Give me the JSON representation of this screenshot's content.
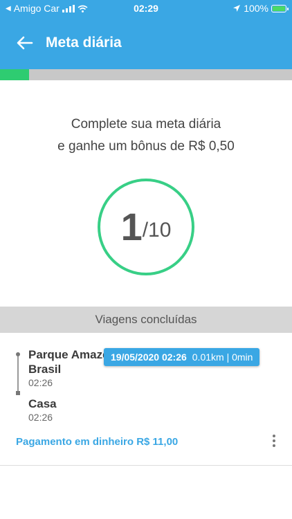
{
  "status_bar": {
    "carrier": "Amigo Car",
    "time": "02:29",
    "battery": "100%"
  },
  "appbar": {
    "title": "Meta diária",
    "back_icon": "arrow-left-icon"
  },
  "goal_progress": {
    "fraction": 0.1,
    "fill_color": "#2ecc71"
  },
  "intro": {
    "line1": "Complete sua meta diária",
    "line2": "e ganhe um bônus de R$ 0,50"
  },
  "goal": {
    "current": "1",
    "total": "/10"
  },
  "section": {
    "title": "Viagens concluídas"
  },
  "trip": {
    "origin_line1": "Parque Amaze",
    "origin_line2": "Brasil",
    "origin_time": "02:26",
    "destination": "Casa",
    "destination_time": "02:26",
    "tooltip_datetime": "19/05/2020 02:26",
    "tooltip_info": "0.01km | 0min",
    "payment": "Pagamento em dinheiro R$ 11,00"
  },
  "colors": {
    "primary": "#3aa7e4",
    "accent_green": "#38cf86"
  }
}
